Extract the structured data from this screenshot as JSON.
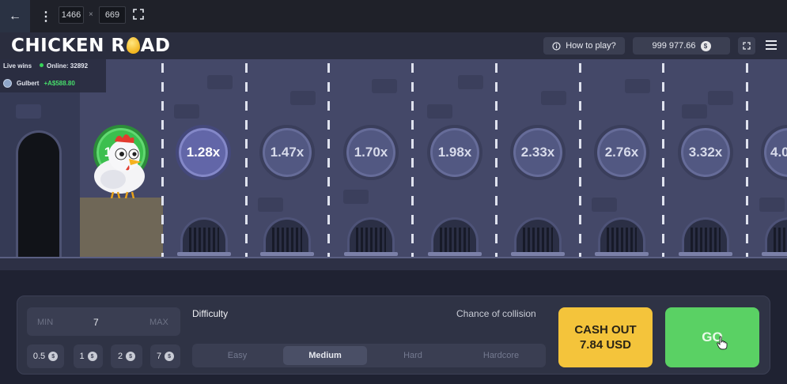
{
  "devbar": {
    "back_icon": "arrow-left-icon",
    "width": "1466",
    "times": "×",
    "height": "669",
    "fullscreen_icon": "fullscreen-icon"
  },
  "header": {
    "logo_left": "CHICKEN R",
    "logo_right": "AD",
    "how_to_play": "How to play?",
    "balance": "999 977.66",
    "currency_symbol": "$"
  },
  "live_wins": {
    "label": "Live wins",
    "online": "Online: 32892",
    "winner_name": "Gulbert",
    "winner_amount": "+A$588.80"
  },
  "multipliers": [
    "1.12x",
    "1.28x",
    "1.47x",
    "1.70x",
    "1.98x",
    "2.33x",
    "2.76x",
    "3.32x",
    "4.0"
  ],
  "bet": {
    "min_label": "MIN",
    "value": "7",
    "max_label": "MAX",
    "chips": [
      "0.5",
      "1",
      "2",
      "7"
    ],
    "chip_currency": "$"
  },
  "difficulty": {
    "title": "Difficulty",
    "chance_title": "Chance of collision",
    "options": [
      "Easy",
      "Medium",
      "Hard",
      "Hardcore"
    ],
    "selected": "Medium"
  },
  "actions": {
    "cashout_line1": "CASH OUT",
    "cashout_line2": "7.84 USD",
    "go": "GO"
  },
  "colors": {
    "green": "#5ad164",
    "yellow": "#f4c43b",
    "wall": "#444868"
  }
}
